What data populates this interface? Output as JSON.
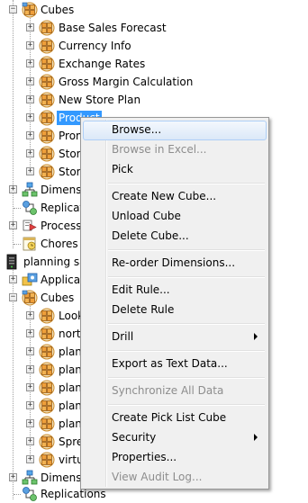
{
  "tree": {
    "top_cubes_label": "Cubes",
    "cubes": [
      {
        "label": "Base Sales Forecast"
      },
      {
        "label": "Currency Info"
      },
      {
        "label": "Exchange Rates"
      },
      {
        "label": "Gross Margin Calculation"
      },
      {
        "label": "New Store Plan"
      },
      {
        "label": "Product"
      },
      {
        "label": "Prom"
      },
      {
        "label": "Store"
      },
      {
        "label": "Store"
      }
    ],
    "dimensions_label": "Dimensi",
    "replication_label": "Replicat",
    "processes_label": "Processe",
    "chores_label": "Chores",
    "server_label": "planning sa",
    "applications_label": "Applicat",
    "cubes2_label": "Cubes",
    "cubes2": [
      {
        "label": "Look"
      },
      {
        "label": "nort"
      },
      {
        "label": "plan"
      },
      {
        "label": "plan"
      },
      {
        "label": "plan"
      },
      {
        "label": "plan"
      },
      {
        "label": "plan"
      },
      {
        "label": "Spre"
      },
      {
        "label": "virtu"
      }
    ],
    "dimensions2_label": "Dimensi",
    "replications2_label": "Replications"
  },
  "context_menu": {
    "items": [
      {
        "label": "Browse...",
        "disabled": false,
        "highlighted": true
      },
      {
        "label": "Browse in Excel...",
        "disabled": true
      },
      {
        "label": "Pick",
        "disabled": false
      },
      {
        "label": "Create New Cube...",
        "disabled": false
      },
      {
        "label": "Unload Cube",
        "disabled": false
      },
      {
        "label": "Delete Cube...",
        "disabled": false
      },
      {
        "label": "Re-order Dimensions...",
        "disabled": false
      },
      {
        "label": "Edit Rule...",
        "disabled": false
      },
      {
        "label": "Delete Rule",
        "disabled": false
      },
      {
        "label": "Drill",
        "disabled": false,
        "submenu": true
      },
      {
        "label": "Export as Text Data...",
        "disabled": false
      },
      {
        "label": "Synchronize All Data",
        "disabled": true
      },
      {
        "label": "Create Pick List Cube",
        "disabled": false
      },
      {
        "label": "Security",
        "disabled": false,
        "submenu": true
      },
      {
        "label": "Properties...",
        "disabled": false
      },
      {
        "label": "View Audit Log...",
        "disabled": true
      }
    ]
  },
  "colors": {
    "selection": "#3399ff",
    "menu_background": "#f0f0f0",
    "disabled_text": "#8d8d8d",
    "cube_icon_body": "#e8a53a",
    "cube_icon_dark": "#b9701a"
  },
  "icons": {
    "cube": "cube-icon",
    "dimensions": "dimension-icon",
    "replication": "replication-icon",
    "processes": "process-icon",
    "chores": "chore-icon",
    "server": "server-icon",
    "applications": "application-icon"
  }
}
